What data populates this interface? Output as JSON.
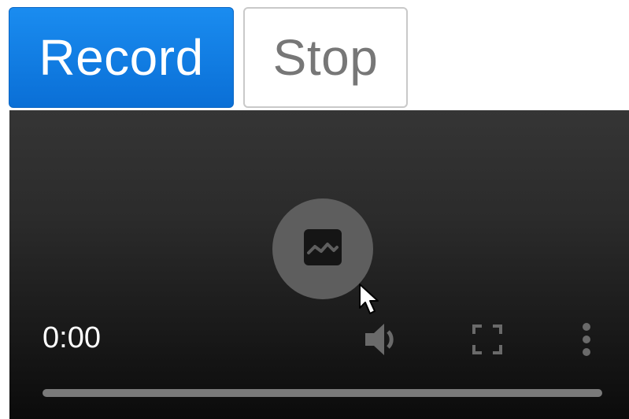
{
  "toolbar": {
    "record_label": "Record",
    "stop_label": "Stop"
  },
  "player": {
    "current_time": "0:00",
    "progress_fraction": 0,
    "center_icon": "broken-image-icon",
    "controls": [
      "volume-icon",
      "fullscreen-icon",
      "more-options-icon"
    ]
  },
  "colors": {
    "record_bg": "#0a78e6",
    "player_bg": "#1a1a1a"
  }
}
